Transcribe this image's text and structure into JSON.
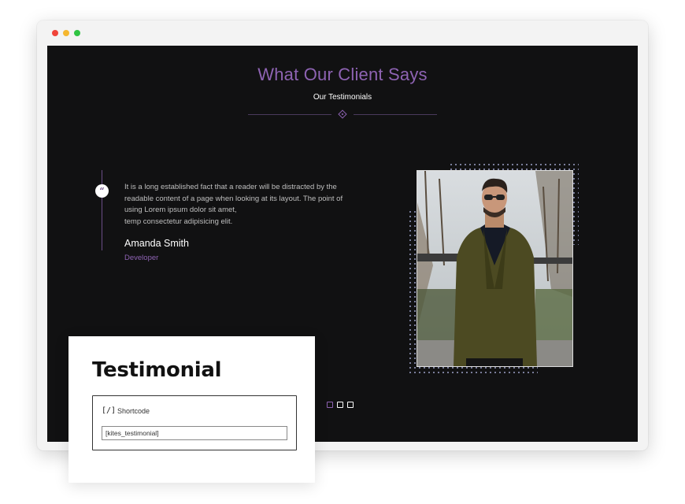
{
  "window": {
    "controls": [
      {
        "name": "close",
        "color": "#f0443a"
      },
      {
        "name": "minimize",
        "color": "#f5b72f"
      },
      {
        "name": "maximize",
        "color": "#2fc443"
      }
    ]
  },
  "section": {
    "title": "What Our Client Says",
    "subtitle": "Our Testimonials",
    "accent_color": "#8e63b3"
  },
  "testimonial": {
    "quote_icon": "quote-icon",
    "text_lines": [
      "It is a long established fact that a reader will be distracted by the",
      "readable content of a page when looking at its layout. The point of",
      "using Lorem ipsum dolor sit amet,",
      "temp consectetur adipisicing elit."
    ],
    "author": "Amanda Smith",
    "role": "Developer",
    "photo": "man-in-olive-blazer-photo"
  },
  "carousel": {
    "dots": 3,
    "active_index": 0
  },
  "card": {
    "title": "Testimonial",
    "shortcode_icon": "[/]",
    "shortcode_label": "Shortcode",
    "shortcode_value": "[kites_testimonial]"
  }
}
